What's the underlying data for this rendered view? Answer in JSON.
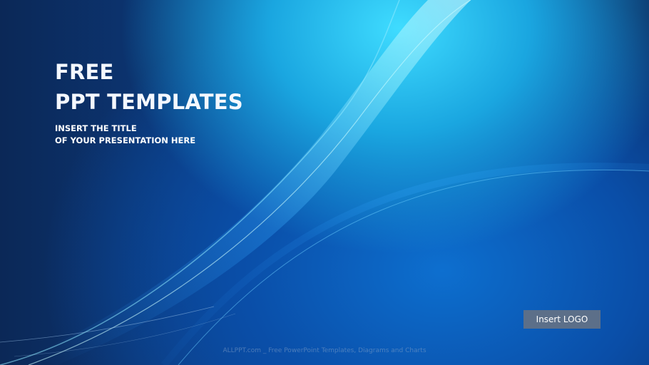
{
  "slide": {
    "title_line1": "FREE",
    "title_line2": "PPT TEMPLATES",
    "subtitle_line1": "INSERT THE TITLE",
    "subtitle_line2": "OF YOUR PRESENTATION HERE",
    "logo_label": "Insert LOGO",
    "footer": "ALLPPT.com _ Free PowerPoint Templates, Diagrams and Charts"
  },
  "colors": {
    "background_dark": "#0b2857",
    "background_mid": "#0c4c9c",
    "glow": "#3fdcff",
    "logo_box": "#5c6f89",
    "text": "#ffffff"
  }
}
